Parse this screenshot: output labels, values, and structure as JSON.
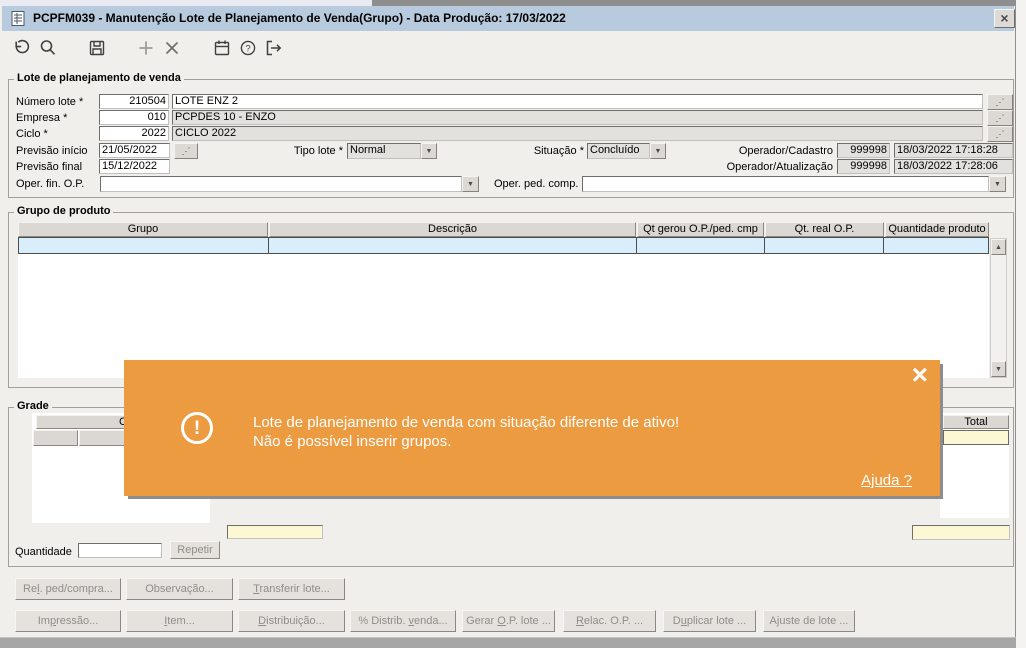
{
  "window": {
    "title": "PCPFM039 - Manutenção Lote de Planejamento de Venda(Grupo) - Data Produção: 17/03/2022"
  },
  "toolbar": {
    "icons": [
      "undo",
      "search",
      "save",
      "add",
      "delete",
      "calendar",
      "help",
      "exit"
    ]
  },
  "glyphs": {
    "lookup": "⋰",
    "combo_arrow": "▼",
    "scroll_up": "▲",
    "scroll_down": "▼",
    "titlebar_close": "×",
    "toast_close": "×",
    "warning": "!"
  },
  "lote": {
    "legend": "Lote de planejamento de venda",
    "numero_lote_label": "Número lote *",
    "numero_lote_value": "210504",
    "numero_lote_desc": "LOTE ENZ 2",
    "empresa_label": "Empresa *",
    "empresa_value": "010",
    "empresa_desc": "PCPDES 10 - ENZO",
    "ciclo_label": "Ciclo *",
    "ciclo_value": "2022",
    "ciclo_desc": "CICLO 2022",
    "previsao_inicio_label": "Previsão início",
    "previsao_inicio_value": "21/05/2022",
    "previsao_final_label": "Previsão final",
    "previsao_final_value": "15/12/2022",
    "tipo_lote_label": "Tipo lote *",
    "tipo_lote_value": "Normal",
    "situacao_label": "Situação *",
    "situacao_value": "Concluído",
    "operador_cadastro_label": "Operador/Cadastro",
    "operador_cadastro_code": "999998",
    "operador_cadastro_datetime": "18/03/2022 17:18:28",
    "operador_atualizacao_label": "Operador/Atualização",
    "operador_atualizacao_code": "999998",
    "operador_atualizacao_datetime": "18/03/2022 17:28:06",
    "oper_fin_op_label": "Oper. fin. O.P.",
    "oper_fin_op_value": "",
    "oper_ped_comp_label": "Oper. ped. comp.",
    "oper_ped_comp_value": ""
  },
  "grupo": {
    "legend": "Grupo de produto",
    "columns": [
      "Grupo",
      "Descrição",
      "Qt gerou O.P./ped. cmp",
      "Qt. real O.P.",
      "Quantidade produto"
    ]
  },
  "grade": {
    "legend": "Grade",
    "header_partial": "C",
    "total_header": "Total",
    "quantidade_label": "Quantidade",
    "quantidade_value": "",
    "repetir_label": "Repetir"
  },
  "notification": {
    "message_line1": "Lote de planejamento de venda com situação diferente de ativo!",
    "message_line2": "Não é possível inserir grupos.",
    "help_link": "Ajuda ?",
    "background_color": "#ed9b40"
  },
  "buttons": {
    "row1": [
      "Rel. ped/compra...",
      "Observação...",
      "Transferir lote..."
    ],
    "row2": [
      "Impressão...",
      "Item...",
      "Distribuição...",
      "% Distrib. venda...",
      "Gerar O.P. lote ...",
      "Relac. O.P. ...",
      "Duplicar lote ...",
      "Ajuste de lote ..."
    ]
  }
}
